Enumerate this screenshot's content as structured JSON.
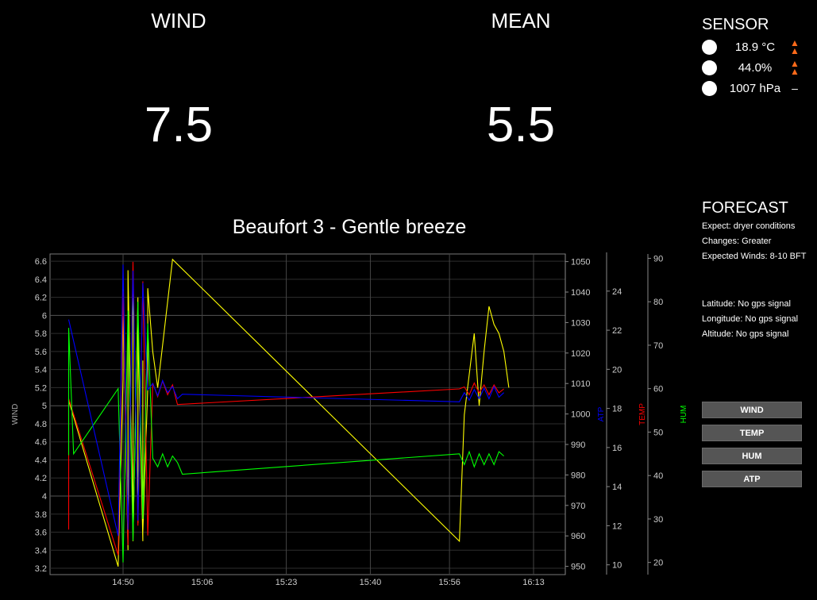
{
  "header": {
    "wind_label": "WIND",
    "wind_value": "7.5",
    "mean_label": "MEAN",
    "mean_value": "5.5",
    "beaufort": "Beaufort 3 - Gentle breeze"
  },
  "sensor": {
    "title": "SENSOR",
    "rows": [
      {
        "value": "18.9 °C",
        "trend": "up",
        "trend_icon": "double-up-arrow-icon"
      },
      {
        "value": "44.0%",
        "trend": "up",
        "trend_icon": "double-up-arrow-icon"
      },
      {
        "value": "1007 hPa",
        "trend": "steady",
        "trend_text": "–"
      }
    ]
  },
  "forecast": {
    "title": "FORECAST",
    "expect": "Expect: dryer conditions",
    "changes": "Changes: Greater",
    "winds": "Expected Winds: 8-10 BFT"
  },
  "gps": {
    "latitude": "Latitude: No gps signal",
    "longitude": "Longitude: No gps signal",
    "altitude": "Altitude: No gps signal"
  },
  "buttons": {
    "wind": "WIND",
    "temp": "TEMP",
    "hum": "HUM",
    "atp": "ATP"
  },
  "colors": {
    "wind": "#ffff00",
    "temp": "#ff0000",
    "hum": "#00ff00",
    "atp": "#0000ff",
    "trend_up": "#ff6a1a"
  },
  "chart_data": {
    "type": "line",
    "x_ticks": [
      "14:50",
      "15:06",
      "15:23",
      "15:40",
      "15:56",
      "16:13"
    ],
    "axes": {
      "wind": {
        "label": "WIND",
        "ticks": [
          "3.2",
          "3.4",
          "3.6",
          "3.8",
          "4",
          "4.2",
          "4.4",
          "4.6",
          "4.8",
          "5",
          "5.2",
          "5.4",
          "5.6",
          "5.8",
          "6",
          "6.2",
          "6.4",
          "6.6"
        ],
        "ylim": [
          3.13,
          6.68
        ]
      },
      "atp": {
        "label": "ATP",
        "ticks": [
          "950",
          "960",
          "970",
          "980",
          "990",
          "1000",
          "1010",
          "1020",
          "1030",
          "1040",
          "1050"
        ],
        "ylim": [
          947.3,
          1052.5
        ]
      },
      "temp": {
        "label": "TEMP",
        "ticks": [
          "10",
          "12",
          "14",
          "16",
          "18",
          "20",
          "22",
          "24"
        ],
        "ylim": [
          9.5,
          25.9
        ]
      },
      "hum": {
        "label": "HUM",
        "ticks": [
          "20",
          "30",
          "40",
          "50",
          "60",
          "70",
          "80",
          "90"
        ],
        "ylim": [
          17.2,
          91.0
        ]
      }
    },
    "series": [
      {
        "name": "WIND",
        "axis": "wind",
        "color": "#ffff00",
        "x": [
          "14:39",
          "14:49",
          "14:50",
          "14:50",
          "14:51",
          "14:51",
          "14:52",
          "14:52",
          "14:52",
          "14:53",
          "14:53",
          "14:53",
          "14:54",
          "14:54",
          "14:54",
          "14:55",
          "14:55",
          "14:56",
          "14:57",
          "15:00",
          "15:58",
          "15:59",
          "16:01",
          "16:02",
          "16:03",
          "16:04",
          "16:05",
          "16:06",
          "16:07",
          "16:08"
        ],
        "y": [
          5.06,
          3.22,
          5.3,
          6.3,
          3.4,
          6.5,
          3.6,
          6.4,
          3.5,
          6.2,
          3.7,
          5.9,
          3.5,
          5.5,
          3.6,
          5.2,
          6.3,
          5.6,
          5.2,
          6.62,
          3.5,
          4.9,
          5.8,
          5.0,
          5.6,
          6.1,
          5.9,
          5.8,
          5.6,
          5.2
        ]
      },
      {
        "name": "TEMP",
        "axis": "temp",
        "color": "#ff0000",
        "x": [
          "14:39",
          "14:39",
          "14:49",
          "14:50",
          "14:51",
          "14:52",
          "14:53",
          "14:54",
          "14:55",
          "14:56",
          "14:57",
          "14:58",
          "14:59",
          "15:00",
          "15:01",
          "15:58",
          "15:59",
          "16:00",
          "16:01",
          "16:02",
          "16:03",
          "16:04",
          "16:05",
          "16:06",
          "16:07"
        ],
        "y": [
          11.8,
          18.5,
          10.5,
          24.0,
          11.0,
          25.5,
          12.0,
          24.5,
          11.5,
          19.3,
          18.6,
          19.4,
          18.7,
          19.2,
          18.2,
          19.0,
          19.1,
          18.7,
          19.3,
          18.8,
          19.2,
          18.7,
          19.2,
          18.8,
          19.0
        ]
      },
      {
        "name": "HUM",
        "axis": "hum",
        "color": "#00ff00",
        "x": [
          "14:39",
          "14:39",
          "14:40",
          "14:49",
          "14:50",
          "14:51",
          "14:52",
          "14:53",
          "14:54",
          "14:55",
          "14:56",
          "14:57",
          "14:58",
          "14:59",
          "15:00",
          "15:01",
          "15:02",
          "15:58",
          "15:59",
          "16:00",
          "16:01",
          "16:02",
          "16:03",
          "16:04",
          "16:05",
          "16:06",
          "16:07"
        ],
        "y": [
          44.7,
          74.0,
          45.0,
          60.0,
          20.0,
          78.0,
          25.0,
          80.0,
          30.0,
          75.0,
          44.0,
          42.0,
          45.0,
          42.0,
          44.5,
          43.0,
          40.3,
          45.0,
          42.5,
          45.5,
          42.0,
          45.0,
          42.5,
          45.0,
          42.5,
          45.5,
          44.5
        ]
      },
      {
        "name": "ATP",
        "axis": "atp",
        "color": "#0000ff",
        "x": [
          "14:39",
          "14:49",
          "14:50",
          "14:51",
          "14:52",
          "14:53",
          "14:54",
          "14:55",
          "14:56",
          "14:57",
          "14:58",
          "14:59",
          "15:00",
          "15:01",
          "15:02",
          "15:58",
          "15:59",
          "16:00",
          "16:01",
          "16:02",
          "16:03",
          "16:04",
          "16:05",
          "16:06",
          "16:07"
        ],
        "y": [
          1031.0,
          960.0,
          1049.0,
          962.0,
          1047.0,
          965.0,
          1043.0,
          1008.0,
          1010.0,
          1006.0,
          1011.0,
          1007.0,
          1009.0,
          1005.0,
          1006.5,
          1004.0,
          1007.0,
          1004.5,
          1008.0,
          1005.0,
          1008.5,
          1005.0,
          1009.0,
          1005.5,
          1007.0
        ]
      }
    ],
    "grid": true
  }
}
